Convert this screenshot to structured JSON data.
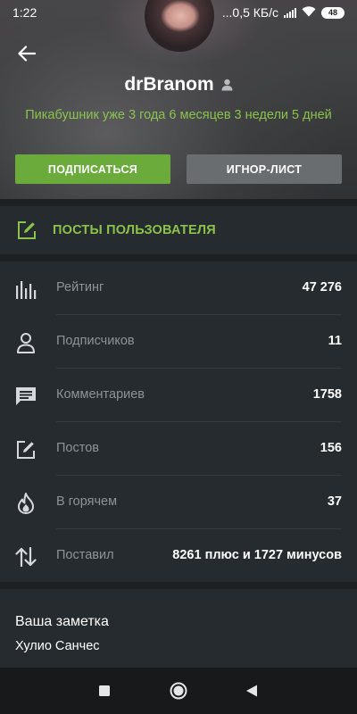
{
  "status_bar": {
    "time": "1:22",
    "network_speed": "...0,5 КБ/с",
    "battery": "48"
  },
  "profile": {
    "username": "drBranom",
    "member_since": "Пикабушник уже 3 года 6 месяцев 3 недели 5 дней",
    "subscribe_label": "ПОДПИСАТЬСЯ",
    "ignore_label": "ИГНОР-ЛИСТ"
  },
  "posts_link": {
    "label": "ПОСТЫ ПОЛЬЗОВАТЕЛЯ"
  },
  "stats": [
    {
      "icon": "bar-chart-icon",
      "label": "Рейтинг",
      "value": "47 276"
    },
    {
      "icon": "person-icon",
      "label": "Подписчиков",
      "value": "11"
    },
    {
      "icon": "comment-icon",
      "label": "Комментариев",
      "value": "1758"
    },
    {
      "icon": "edit-icon",
      "label": "Постов",
      "value": "156"
    },
    {
      "icon": "flame-icon",
      "label": "В горячем",
      "value": "37"
    },
    {
      "icon": "up-down-arrows-icon",
      "label": "Поставил",
      "value": "8261 плюс и 1727 минусов"
    }
  ],
  "note": {
    "title": "Ваша заметка",
    "text": "Хулио Санчес"
  },
  "colors": {
    "accent_green": "#8bc34a",
    "subscribe_button": "#6aab3c",
    "ignore_button": "#6a6d70",
    "background": "#1c2023",
    "card": "#262b2f"
  }
}
